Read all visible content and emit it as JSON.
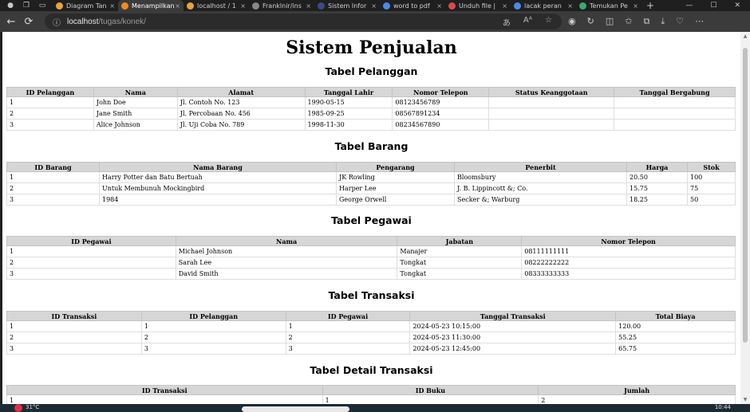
{
  "browser": {
    "tabs": [
      {
        "label": "Diagram Tan",
        "color": "#e8a33a"
      },
      {
        "label": "Menampilkan",
        "color": "#f08a24",
        "active": true
      },
      {
        "label": "localhost / 1",
        "color": "#e8a33a"
      },
      {
        "label": "Franklnir/ins",
        "color": "#888888"
      },
      {
        "label": "Sistem Infor",
        "color": "#3a4a8a"
      },
      {
        "label": "word to pdf",
        "color": "#4a8ae8"
      },
      {
        "label": "Unduh file |",
        "color": "#d94a4a"
      },
      {
        "label": "lacak peran",
        "color": "#4a8ae8"
      },
      {
        "label": "Temukan Pe",
        "color": "#3aa86a"
      }
    ],
    "url_host": "localhost",
    "url_path": "/tugas/konek/"
  },
  "page": {
    "title": "Sistem Penjualan",
    "pelanggan": {
      "heading": "Tabel Pelanggan",
      "columns": [
        "ID Pelanggan",
        "Nama",
        "Alamat",
        "Tanggal Lahir",
        "Nomor Telepon",
        "Status Keanggotaan",
        "Tanggal Bergabung"
      ],
      "rows": [
        [
          "1",
          "John Doe",
          "Jl. Contoh No. 123",
          "1990-05-15",
          "08123456789",
          "",
          ""
        ],
        [
          "2",
          "Jane Smith",
          "Jl. Percobaan No. 456",
          "1985-09-25",
          "08567891234",
          "",
          ""
        ],
        [
          "3",
          "Alice Johnson",
          "Jl. Uji Coba No. 789",
          "1998-11-30",
          "08234567890",
          "",
          ""
        ]
      ]
    },
    "barang": {
      "heading": "Tabel Barang",
      "columns": [
        "ID Barang",
        "Nama Barang",
        "Pengarang",
        "Penerbit",
        "Harga",
        "Stok"
      ],
      "rows": [
        [
          "1",
          "Harry Potter dan Batu Bertuah",
          "JK Rowling",
          "Bloomsbury",
          "20.50",
          "100"
        ],
        [
          "2",
          "Untuk Membunuh Mockingbird",
          "Harper Lee",
          "J. B. Lippincott &; Co.",
          "15.75",
          "75"
        ],
        [
          "3",
          "1984",
          "George Orwell",
          "Secker &; Warburg",
          "18.25",
          "50"
        ]
      ]
    },
    "pegawai": {
      "heading": "Tabel Pegawai",
      "columns": [
        "ID Pegawai",
        "Nama",
        "Jabatan",
        "Nomor Telepon"
      ],
      "rows": [
        [
          "1",
          "Michael Johnson",
          "Manajer",
          "08111111111"
        ],
        [
          "2",
          "Sarah Lee",
          "Tongkat",
          "08222222222"
        ],
        [
          "3",
          "David Smith",
          "Tongkat",
          "08333333333"
        ]
      ]
    },
    "transaksi": {
      "heading": "Tabel Transaksi",
      "columns": [
        "ID Transaksi",
        "ID Pelanggan",
        "ID Pegawai",
        "Tanggal Transaksi",
        "Total Biaya"
      ],
      "rows": [
        [
          "1",
          "1",
          "1",
          "2024-05-23 10:15:00",
          "120.00"
        ],
        [
          "2",
          "2",
          "2",
          "2024-05-23 11:30:00",
          "55.25"
        ],
        [
          "3",
          "3",
          "3",
          "2024-05-23 12:45:00",
          "65.75"
        ]
      ]
    },
    "detail": {
      "heading": "Tabel Detail Transaksi",
      "columns": [
        "ID Transaksi",
        "ID Buku",
        "Jumlah"
      ],
      "rows": [
        [
          "1",
          "1",
          "2"
        ]
      ]
    }
  },
  "taskbar": {
    "weather": "31°C",
    "clock": "10:44"
  }
}
